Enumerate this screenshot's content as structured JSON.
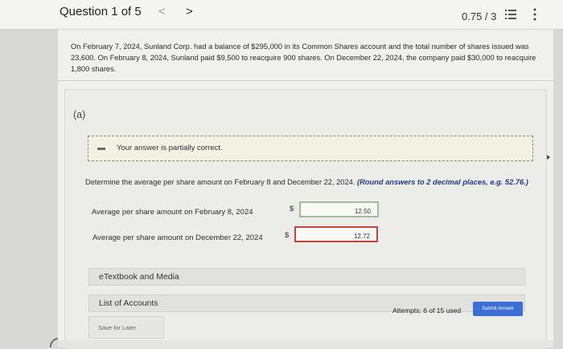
{
  "header": {
    "question_title": "Question 1 of 5",
    "prev_glyph": "<",
    "next_glyph": ">",
    "score": "0.75 / 3",
    "list_icon": "list-icon",
    "more_icon": "more-vertical-icon"
  },
  "question": {
    "text": "On February 7, 2024, Sunland Corp. had a balance of $295,000 in its Common Shares account and the total number of shares issued was 23,600. On February 8, 2024, Sunland paid $9,500 to reacquire 900 shares. On December 22, 2024, the company paid $30,000 to reacquire 1,800 shares."
  },
  "part": {
    "label": "(a)",
    "feedback": "Your answer is partially correct.",
    "instruction": "Determine the average per share amount on February 8 and December 22, 2024.",
    "instruction_hint": "(Round answers to 2 decimal places, e.g. 52.76.)",
    "rows": [
      {
        "label": "Average per share amount on February 8, 2024",
        "currency": "$",
        "value": "12.50"
      },
      {
        "label": "Average per share amount on December 22, 2024",
        "currency": "$",
        "value": "12.72"
      }
    ]
  },
  "actions": {
    "etextbook": "eTextbook and Media",
    "list_of_accounts": "List of Accounts",
    "save_later": "Save for Later",
    "attempts": "Attempts: 6 of 15 used",
    "submit": "Submit Answer"
  },
  "colors": {
    "correct_border": "#9ebc98",
    "incorrect_border": "#c4453f",
    "submit_bg": "#3b6fd6",
    "hint_text": "#1f3a8a"
  }
}
